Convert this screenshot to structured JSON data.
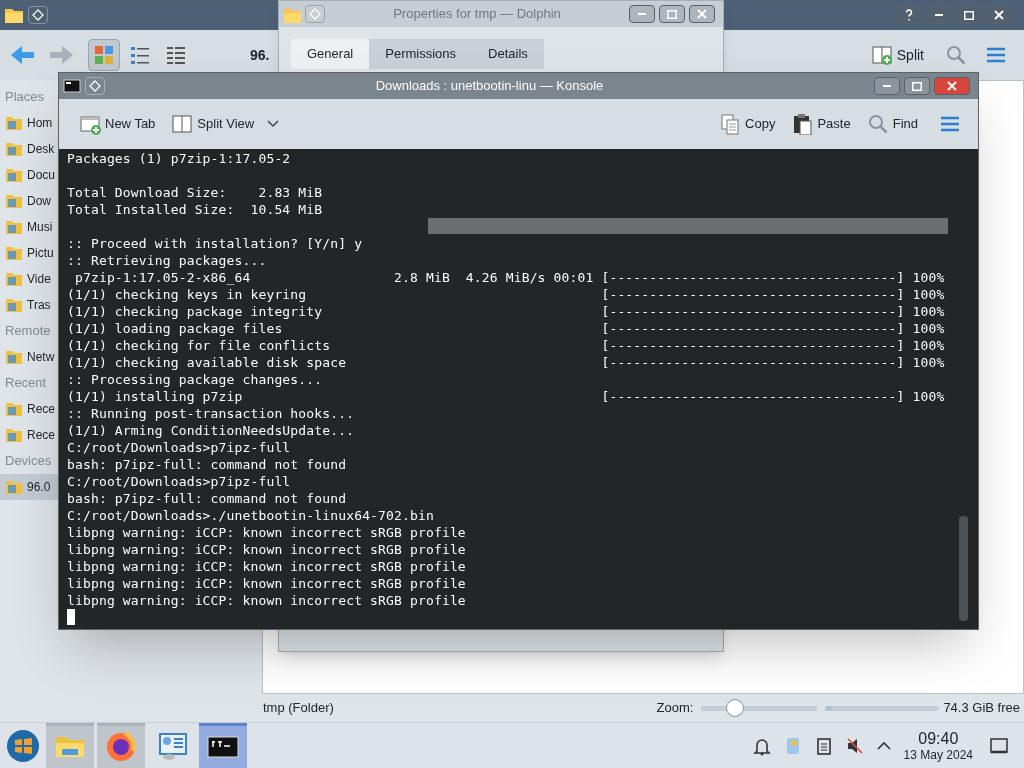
{
  "dolphin": {
    "toolbar": {
      "location": "96.",
      "split": "Split"
    },
    "view_modes": [
      {
        "selected": true
      },
      {
        "selected": false
      },
      {
        "selected": false
      }
    ],
    "places": [
      {
        "kind": "header",
        "label": "Places"
      },
      {
        "kind": "item",
        "label": "Hom",
        "selected": false
      },
      {
        "kind": "item",
        "label": "Desk",
        "selected": false
      },
      {
        "kind": "item",
        "label": "Docu",
        "selected": false
      },
      {
        "kind": "item",
        "label": "Dow",
        "selected": false
      },
      {
        "kind": "item",
        "label": "Musi",
        "selected": false
      },
      {
        "kind": "item",
        "label": "Pictu",
        "selected": false
      },
      {
        "kind": "item",
        "label": "Vide",
        "selected": false
      },
      {
        "kind": "item",
        "label": "Tras",
        "selected": false
      },
      {
        "kind": "header",
        "label": "Remote"
      },
      {
        "kind": "item",
        "label": "Netw",
        "selected": false
      },
      {
        "kind": "header",
        "label": "Recent"
      },
      {
        "kind": "item",
        "label": "Rece",
        "selected": false
      },
      {
        "kind": "item",
        "label": "Rece",
        "selected": false
      },
      {
        "kind": "header",
        "label": "Devices"
      },
      {
        "kind": "item",
        "label": "96.0",
        "selected": true
      }
    ],
    "status": "tmp (Folder)",
    "zoom_label": "Zoom:",
    "zoom": {
      "level": 0.25
    },
    "disk": {
      "level": 0.06,
      "reading": "74.3 GiB free"
    }
  },
  "properties_dialog": {
    "title": "Properties for tmp — Dolphin",
    "tabs": [
      {
        "label": "General",
        "selected": true
      },
      {
        "label": "Permissions",
        "selected": false
      },
      {
        "label": "Details",
        "selected": false
      }
    ]
  },
  "konsole": {
    "title": "Downloads : unetbootin-linu — Konsole",
    "toolbar_left": [
      {
        "label": "New Tab",
        "kind": "newtab"
      },
      {
        "label": "Split View",
        "kind": "split"
      }
    ],
    "toolbar_right": [
      {
        "label": "Copy",
        "kind": "copy"
      },
      {
        "label": "Paste",
        "kind": "paste"
      },
      {
        "label": "Find",
        "kind": "find"
      }
    ],
    "lines": [
      "Packages (1) p7zip-1:17.05-2",
      {
        "kind": "blank"
      },
      "Total Download Size:    2.83 MiB",
      "Total Installed Size:  10.54 MiB",
      {
        "kind": "blank"
      },
      ":: Proceed with installation? [Y/n] y",
      ":: Retrieving packages...",
      " p7zip-1:17.05-2-x86_64                  2.8 MiB  4.26 MiB/s 00:01 [------------------------------------] 100%",
      "(1/1) checking keys in keyring                                     [------------------------------------] 100%",
      "(1/1) checking package integrity                                   [------------------------------------] 100%",
      "(1/1) loading package files                                        [------------------------------------] 100%",
      "(1/1) checking for file conflicts                                  [------------------------------------] 100%",
      "(1/1) checking available disk space                                [------------------------------------] 100%",
      ":: Processing package changes...",
      "(1/1) installing p7zip                                             [------------------------------------] 100%",
      ":: Running post-transaction hooks...",
      "(1/1) Arming ConditionNeedsUpdate...",
      "C:/root/Downloads>p7ipz-full",
      "bash: p7ipz-full: command not found",
      "C:/root/Downloads>p7ipz-full",
      "bash: p7ipz-full: command not found",
      "C:/root/Downloads>./unetbootin-linux64-702.bin",
      "libpng warning: iCCP: known incorrect sRGB profile",
      "libpng warning: iCCP: known incorrect sRGB profile",
      "libpng warning: iCCP: known incorrect sRGB profile",
      "libpng warning: iCCP: known incorrect sRGB profile",
      "libpng warning: iCCP: known incorrect sRGB profile"
    ]
  },
  "taskbar": {
    "tasks": [
      {
        "kind": "files",
        "open": true,
        "selected": false
      },
      {
        "kind": "browser",
        "open": true,
        "selected": false
      },
      {
        "kind": "settings",
        "open": false,
        "selected": false
      },
      {
        "kind": "terminal",
        "open": true,
        "selected": true
      }
    ],
    "clock": {
      "time": "09:40",
      "date": "13 May 2024"
    }
  }
}
